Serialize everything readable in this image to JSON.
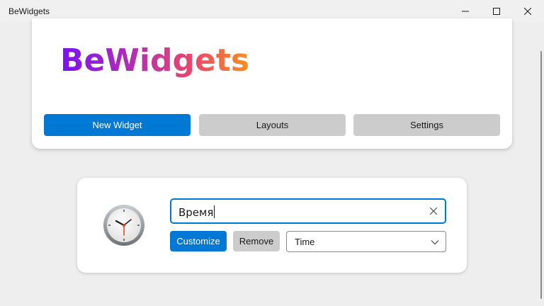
{
  "window": {
    "title": "BeWidgets",
    "controls": [
      "minimize-icon",
      "maximize-icon",
      "close-icon"
    ]
  },
  "header": {
    "logo_text": "BeWidgets",
    "logo_gradient": [
      "#7a12f2",
      "#b62fb0",
      "#e8486a",
      "#f8901e"
    ],
    "nav": {
      "new_widget": "New Widget",
      "layouts": "Layouts",
      "settings": "Settings"
    }
  },
  "widget": {
    "icon": "clock-icon",
    "name_value": "Время",
    "customize_label": "Customize",
    "remove_label": "Remove",
    "type_selected": "Time"
  },
  "colors": {
    "accent": "#0078d4",
    "secondary_button": "#cccccc",
    "background": "#eeeeee"
  }
}
